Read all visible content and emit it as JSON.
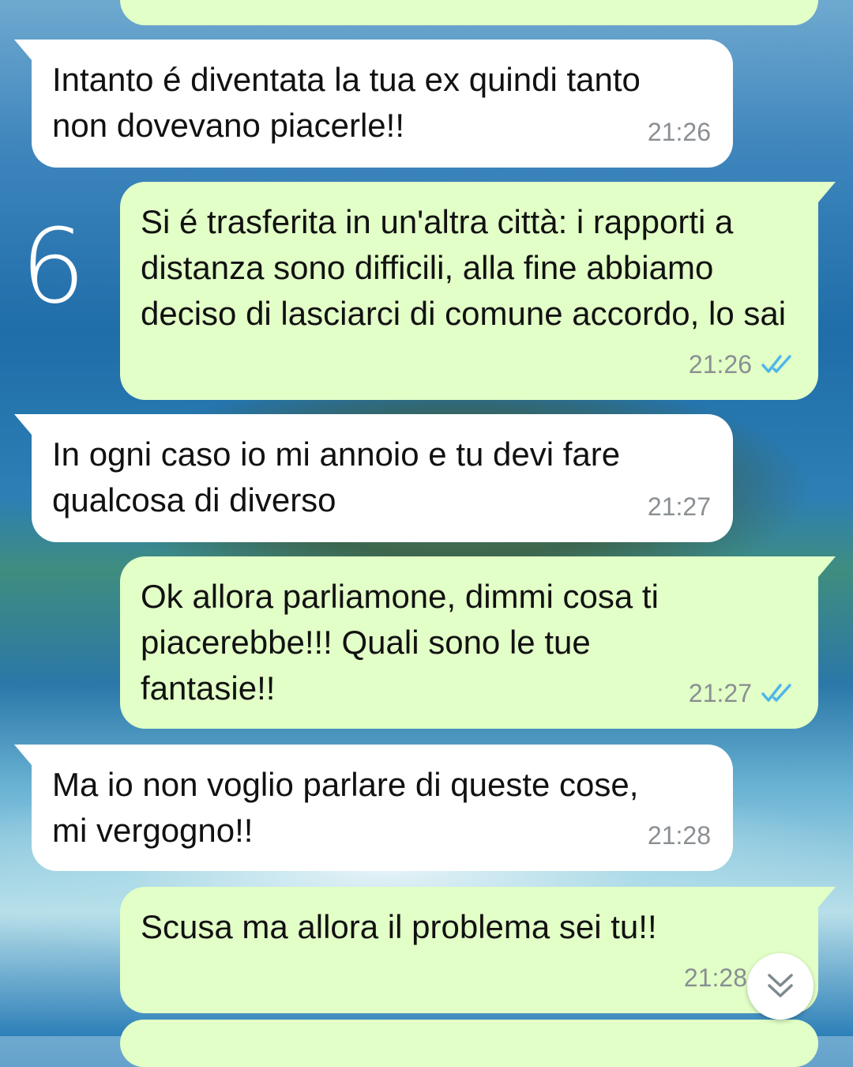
{
  "annotation": {
    "text": "6"
  },
  "messages": [
    {
      "direction": "in",
      "text": "Intanto é diventata la tua ex quindi tanto non dovevano piacerle!!",
      "time": "21:26"
    },
    {
      "direction": "out",
      "text": "Si é trasferita in un'altra città: i rapporti a distanza sono difficili, alla fine abbiamo deciso di lasciarci di comune accordo, lo sai",
      "time": "21:26",
      "status_icon": "double-check-read-icon"
    },
    {
      "direction": "in",
      "text": "In ogni caso io mi annoio e tu devi fare qualcosa di diverso",
      "time": "21:27"
    },
    {
      "direction": "out",
      "text": "Ok allora parliamone, dimmi cosa ti piacerebbe!!! Quali sono le tue fantasie!!",
      "time": "21:27",
      "status_icon": "double-check-read-icon"
    },
    {
      "direction": "in",
      "text": "Ma io non voglio parlare di queste cose, mi vergogno!!",
      "time": "21:28"
    },
    {
      "direction": "out",
      "text": "Scusa ma allora il problema sei tu!!",
      "time": "21:28",
      "status_icon": "double-check-read-icon"
    }
  ],
  "colors": {
    "incoming_bubble": "#ffffff",
    "outgoing_bubble": "#e2ffc7",
    "read_tick": "#4fb6ec",
    "timestamp": "#8a8f93"
  },
  "scroll_button": {
    "icon": "chevrons-down-icon"
  }
}
